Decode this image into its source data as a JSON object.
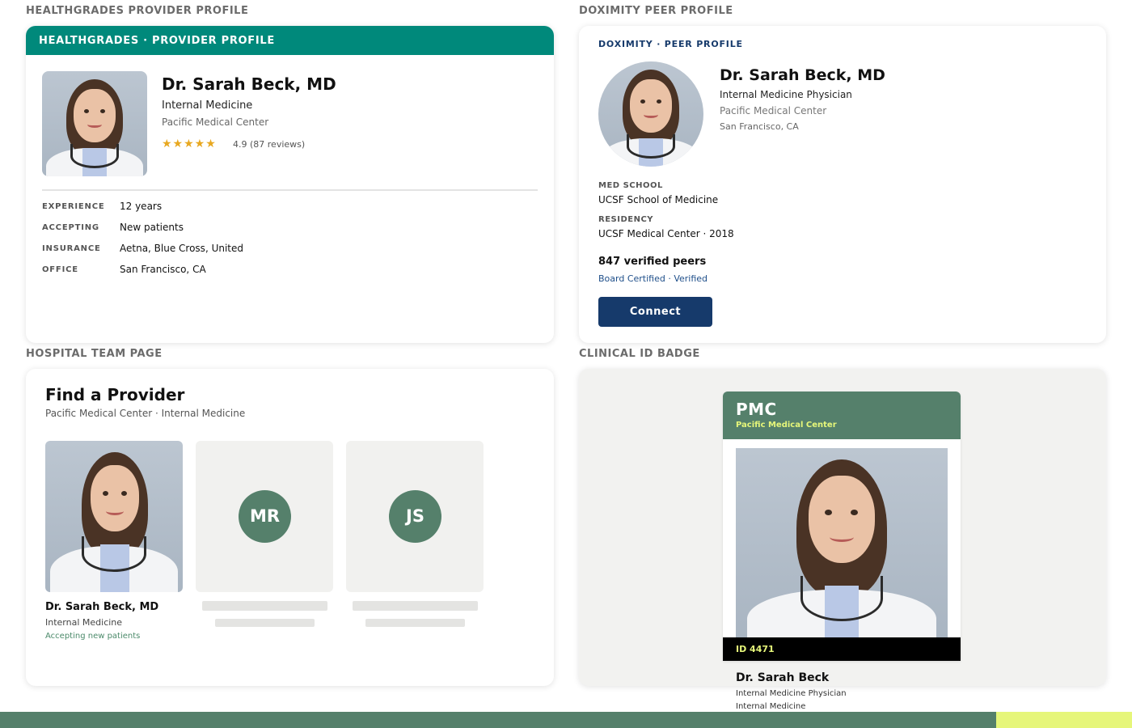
{
  "sections": {
    "healthgrades": "HEALTHGRADES PROVIDER PROFILE",
    "doximity": "DOXIMITY PEER PROFILE",
    "team": "HOSPITAL TEAM PAGE",
    "badge": "CLINICAL ID BADGE"
  },
  "healthgrades": {
    "header": "HEALTHGRADES · PROVIDER PROFILE",
    "name": "Dr. Sarah Beck, MD",
    "specialty": "Internal Medicine",
    "organization": "Pacific Medical Center",
    "stars": "★★★★★",
    "rating_value": 4.9,
    "rating_text": "4.9 (87 reviews)",
    "details": [
      {
        "label": "EXPERIENCE",
        "value": "12 years"
      },
      {
        "label": "ACCEPTING",
        "value": "New patients"
      },
      {
        "label": "INSURANCE",
        "value": "Aetna, Blue Cross, United"
      },
      {
        "label": "OFFICE",
        "value": "San Francisco, CA"
      }
    ],
    "colors": {
      "header": "#00897b",
      "stars": "#e8a820"
    }
  },
  "doximity": {
    "header": "DOXIMITY · PEER PROFILE",
    "name": "Dr. Sarah Beck, MD",
    "specialty": "Internal Medicine Physician",
    "organization": "Pacific Medical Center",
    "location": "San Francisco, CA",
    "med_school_label": "MED SCHOOL",
    "med_school": "UCSF School of Medicine",
    "residency_label": "RESIDENCY",
    "residency": "UCSF Medical Center · 2018",
    "peers": "847 verified peers",
    "board": "Board Certified · Verified",
    "connect_label": "Connect",
    "colors": {
      "brand": "#163a6b"
    }
  },
  "team": {
    "title": "Find a Provider",
    "subtitle": "Pacific Medical Center · Internal Medicine",
    "featured": {
      "name": "Dr. Sarah Beck, MD",
      "specialty": "Internal Medicine",
      "status": "Accepting new patients"
    },
    "placeholders": [
      {
        "initials": "MR"
      },
      {
        "initials": "JS"
      }
    ]
  },
  "badge": {
    "org_short": "PMC",
    "org_full": "Pacific Medical Center",
    "id": "ID 4471",
    "name": "Dr. Sarah Beck",
    "title": "Internal Medicine Physician",
    "department": "Internal Medicine",
    "colors": {
      "primary": "#55806b",
      "accent": "#e6f67a"
    }
  }
}
